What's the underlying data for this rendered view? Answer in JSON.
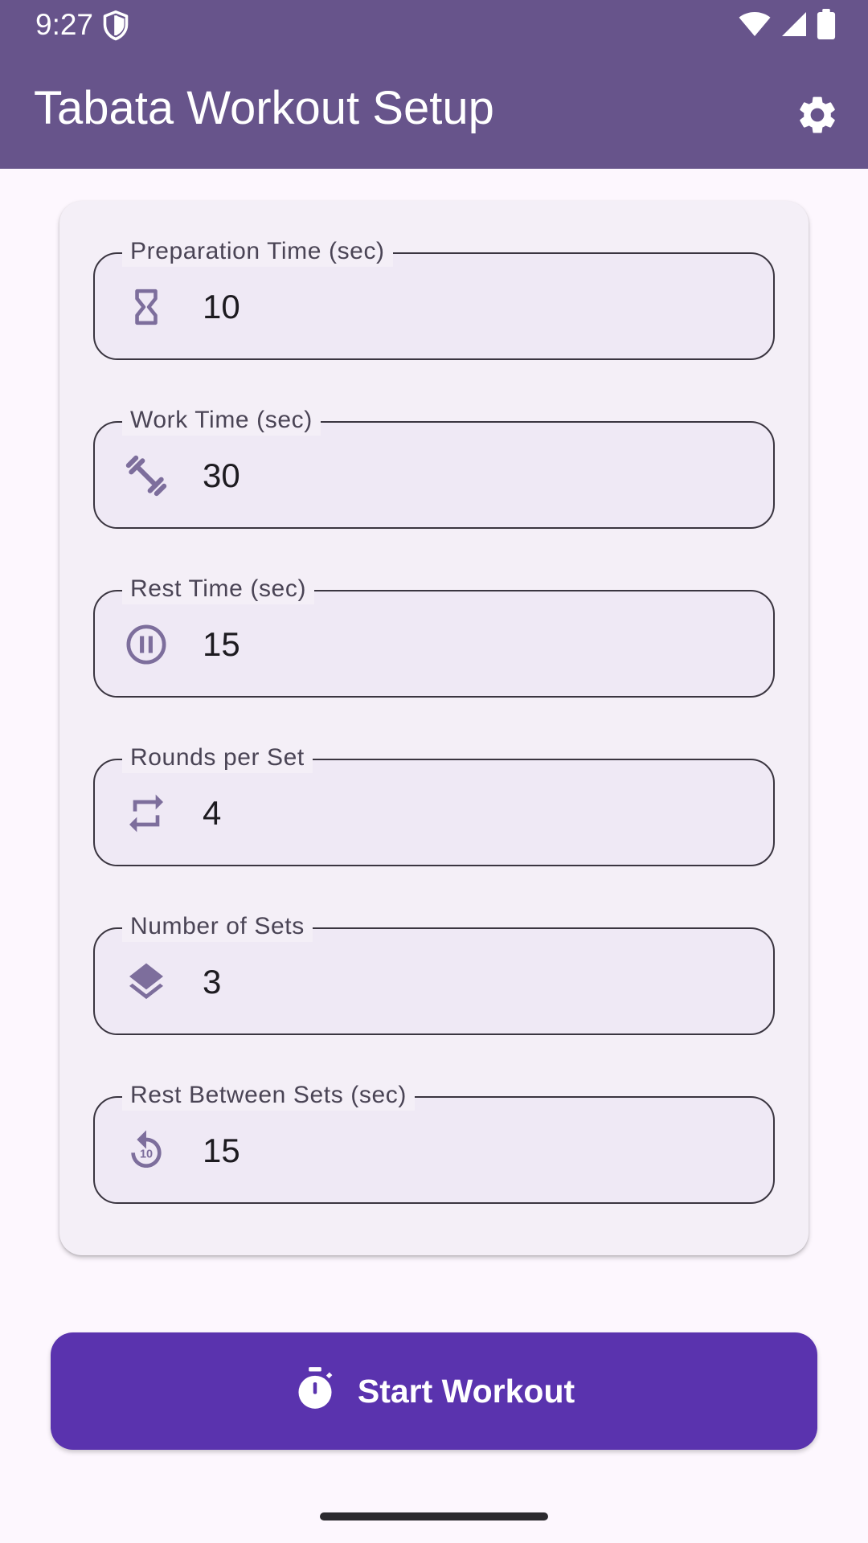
{
  "status_bar": {
    "time": "9:27",
    "icons": [
      "shield-icon",
      "wifi-icon",
      "signal-icon",
      "battery-icon"
    ]
  },
  "app_bar": {
    "title": "Tabata Workout Setup",
    "action_icon": "gear-icon"
  },
  "fields": [
    {
      "label": "Preparation Time (sec)",
      "value": "10",
      "icon": "hourglass-icon"
    },
    {
      "label": "Work Time (sec)",
      "value": "30",
      "icon": "dumbbell-icon"
    },
    {
      "label": "Rest Time (sec)",
      "value": "15",
      "icon": "pause-circle-icon"
    },
    {
      "label": "Rounds per Set",
      "value": "4",
      "icon": "repeat-icon"
    },
    {
      "label": "Number of Sets",
      "value": "3",
      "icon": "layers-icon"
    },
    {
      "label": "Rest Between Sets (sec)",
      "value": "15",
      "icon": "replay-10-icon"
    }
  ],
  "start_button": {
    "label": "Start Workout",
    "icon": "stopwatch-icon"
  },
  "colors": {
    "app_bar": "#67548b",
    "primary_button": "#5a33ae",
    "icon_tint": "#7d6e9c",
    "background": "#fdf7fe"
  }
}
